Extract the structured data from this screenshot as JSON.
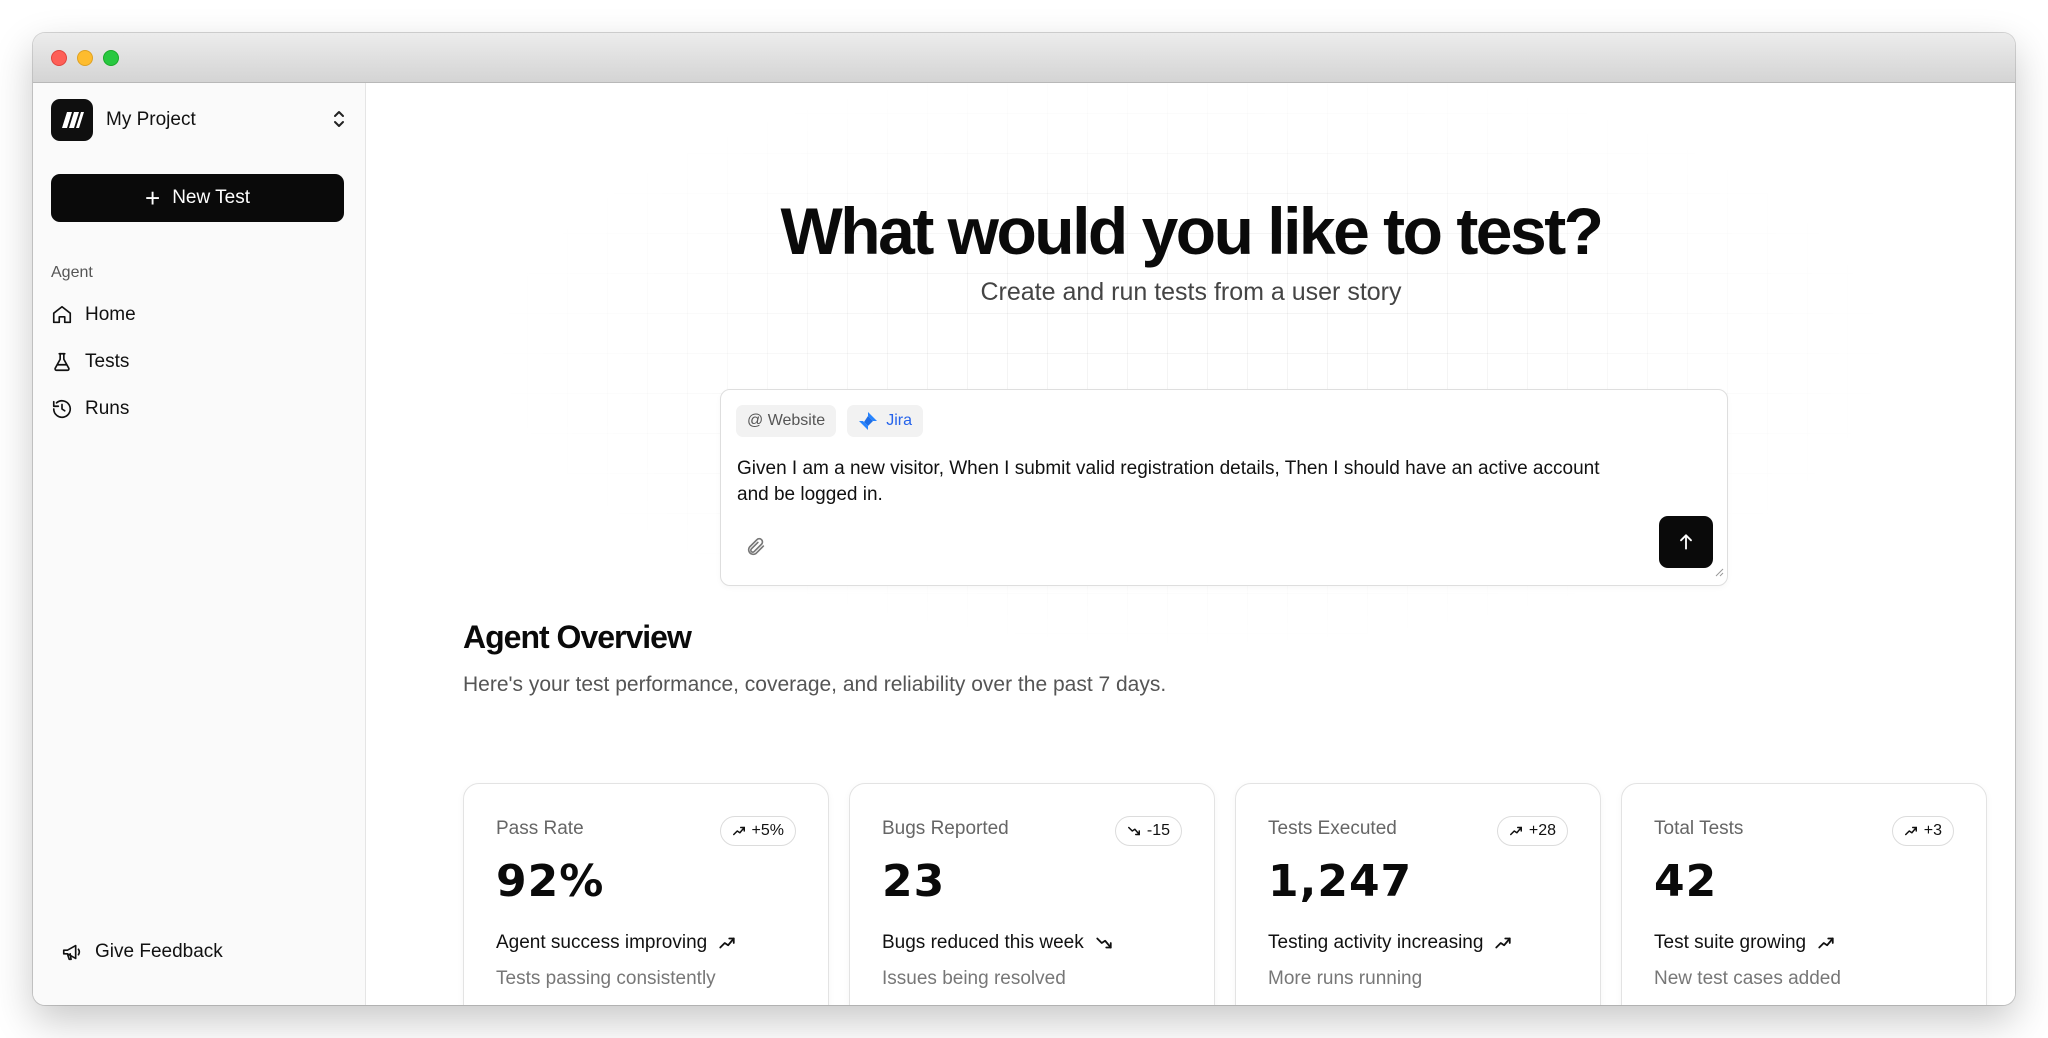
{
  "sidebar": {
    "project_name": "My Project",
    "new_test_label": "New Test",
    "section_label": "Agent",
    "nav_items": [
      {
        "label": "Home",
        "icon": "home-icon"
      },
      {
        "label": "Tests",
        "icon": "flask-icon"
      },
      {
        "label": "Runs",
        "icon": "history-icon"
      }
    ],
    "feedback_label": "Give Feedback"
  },
  "hero": {
    "title": "What would you like to test?",
    "subtitle": "Create and run tests from a user story"
  },
  "composer": {
    "chips": [
      {
        "label": "@ Website",
        "icon": null
      },
      {
        "label": "Jira",
        "icon": "jira-icon"
      }
    ],
    "story_text": "Given I am a new visitor, When I submit valid registration details, Then I should have an active account\nand be logged in.",
    "attach_icon": "paperclip-icon",
    "send_icon": "arrow-up-icon"
  },
  "overview": {
    "title": "Agent Overview",
    "description": "Here's your test performance, coverage, and reliability over the past 7 days.",
    "cards": [
      {
        "label": "Pass Rate",
        "badge": "+5%",
        "trend": "up",
        "value": "92%",
        "headline": "Agent success improving",
        "subtext": "Tests passing consistently"
      },
      {
        "label": "Bugs Reported",
        "badge": "-15",
        "trend": "down",
        "value": "23",
        "headline": "Bugs reduced this week",
        "subtext": "Issues being resolved"
      },
      {
        "label": "Tests Executed",
        "badge": "+28",
        "trend": "up",
        "value": "1,247",
        "headline": "Testing activity increasing",
        "subtext": "More runs running"
      },
      {
        "label": "Total Tests",
        "badge": "+3",
        "trend": "up",
        "value": "42",
        "headline": "Test suite growing",
        "subtext": "New test cases added"
      }
    ]
  },
  "colors": {
    "accent": "#0a0a0a",
    "jira": "#2563eb",
    "sidebar_bg": "#fafafa"
  }
}
